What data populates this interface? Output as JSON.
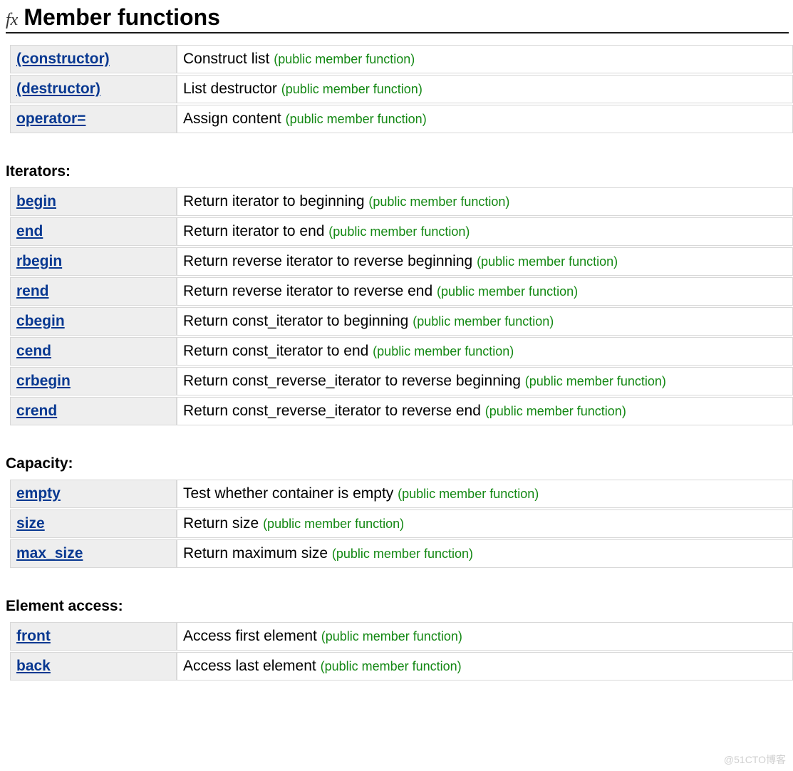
{
  "heading": {
    "icon_text": "fx",
    "title": "Member functions"
  },
  "note_text": "(public member function)",
  "groups": [
    {
      "title": null,
      "items": [
        {
          "name": "(constructor)",
          "desc": "Construct list"
        },
        {
          "name": "(destructor)",
          "desc": "List destructor"
        },
        {
          "name": "operator=",
          "desc": "Assign content"
        }
      ]
    },
    {
      "title": "Iterators:",
      "items": [
        {
          "name": "begin",
          "desc": "Return iterator to beginning"
        },
        {
          "name": "end",
          "desc": "Return iterator to end"
        },
        {
          "name": "rbegin",
          "desc": "Return reverse iterator to reverse beginning"
        },
        {
          "name": "rend",
          "desc": "Return reverse iterator to reverse end"
        },
        {
          "name": "cbegin",
          "desc": "Return const_iterator to beginning"
        },
        {
          "name": "cend",
          "desc": "Return const_iterator to end"
        },
        {
          "name": "crbegin",
          "desc": "Return const_reverse_iterator to reverse beginning"
        },
        {
          "name": "crend",
          "desc": "Return const_reverse_iterator to reverse end"
        }
      ]
    },
    {
      "title": "Capacity:",
      "items": [
        {
          "name": "empty",
          "desc": "Test whether container is empty"
        },
        {
          "name": "size",
          "desc": "Return size"
        },
        {
          "name": "max_size",
          "desc": "Return maximum size"
        }
      ]
    },
    {
      "title": "Element access:",
      "items": [
        {
          "name": "front",
          "desc": "Access first element"
        },
        {
          "name": "back",
          "desc": "Access last element"
        }
      ]
    }
  ],
  "watermark": "@51CTO博客"
}
